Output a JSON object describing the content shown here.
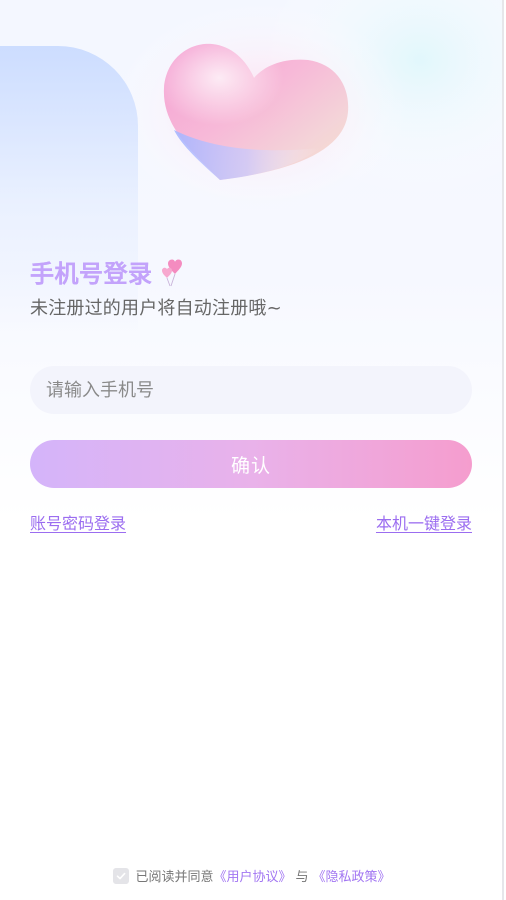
{
  "login": {
    "title": "手机号登录",
    "subtitle": "未注册过的用户将自动注册哦~",
    "phone_placeholder": "请输入手机号",
    "phone_value": "",
    "confirm_label": "确认",
    "account_password_login": "账号密码登录",
    "one_click_login": "本机一键登录"
  },
  "agreement": {
    "checked": false,
    "prefix": "已阅读并同意",
    "user_agreement": "《用户协议》",
    "conjunction": "与",
    "privacy_policy": "《隐私政策》"
  },
  "icons": {
    "hero": "heart-icon",
    "title_decoration": "heart-balloon-icon",
    "agreement_checkbox": "check-icon"
  },
  "colors": {
    "title": "#c3a3fb",
    "link": "#9b6df0",
    "button_start": "#d4b4fa",
    "button_end": "#f59dce",
    "input_bg": "#f3f4fc",
    "agreement_link": "#a276f2"
  }
}
